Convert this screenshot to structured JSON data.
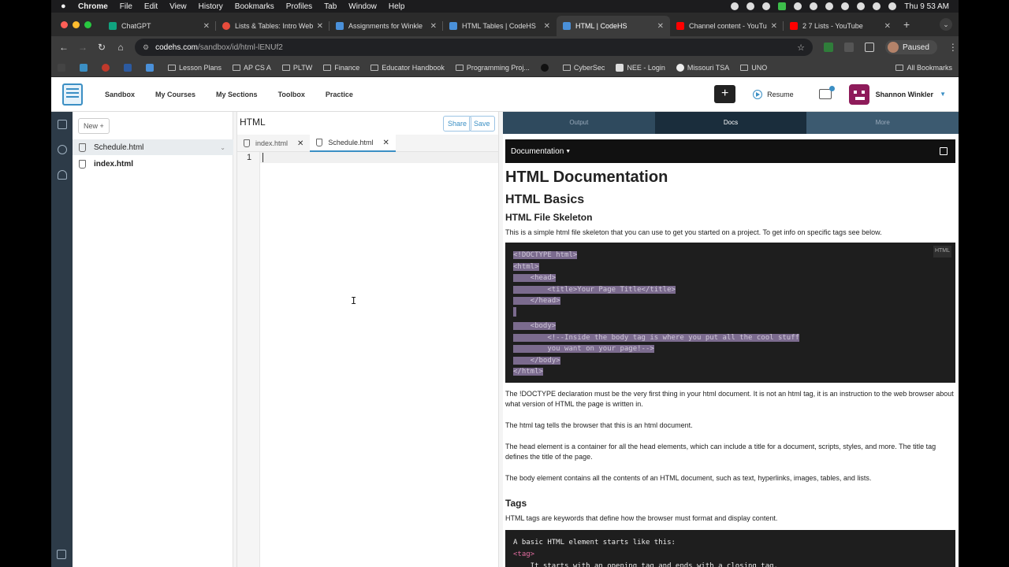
{
  "menubar": {
    "app": "Chrome",
    "items": [
      "File",
      "Edit",
      "View",
      "History",
      "Bookmarks",
      "Profiles",
      "Tab",
      "Window",
      "Help"
    ],
    "clock": "Thu 9 53 AM"
  },
  "tabs": [
    {
      "title": "ChatGPT",
      "color": "#10a37f"
    },
    {
      "title": "Lists & Tables: Intro Web",
      "color": "#e74c3c"
    },
    {
      "title": "Assignments for Winkle",
      "color": "#4a90d9"
    },
    {
      "title": "HTML Tables | CodeHS",
      "color": "#4a90d9"
    },
    {
      "title": "HTML | CodeHS",
      "color": "#4a90d9",
      "active": true
    },
    {
      "title": "Channel content - YouTu",
      "color": "#ff0000"
    },
    {
      "title": "2 7 Lists - YouTube",
      "color": "#ff0000"
    }
  ],
  "address": {
    "host": "codehs.com",
    "path": "/sandbox/id/html-lENUf2"
  },
  "profile": {
    "label": "Paused"
  },
  "bookmarks": [
    "Lesson Plans",
    "AP CS A",
    "PLTW",
    "Finance",
    "Educator Handbook",
    "Programming Proj...",
    "CyberSec",
    "NEE - Login",
    "Missouri TSA",
    "UNO"
  ],
  "bookmarks_all": "All Bookmarks",
  "codehs": {
    "nav": [
      "Sandbox",
      "My Courses",
      "My Sections",
      "Toolbox",
      "Practice"
    ],
    "resume": "Resume",
    "user": "Shannon Winkler",
    "plus": "+"
  },
  "files": {
    "new_button": "New +",
    "items": [
      "Schedule.html",
      "index.html"
    ]
  },
  "editor": {
    "title": "HTML",
    "share": "Share",
    "save": "Save",
    "tabs": [
      "index.html",
      "Schedule.html"
    ],
    "line": "1"
  },
  "panel": {
    "tabs": [
      "Output",
      "Docs",
      "More"
    ],
    "doc_menu": "Documentation",
    "h1": "HTML Documentation",
    "h2": "HTML Basics",
    "h3": "HTML File Skeleton",
    "intro": "This is a simple html file skeleton that you can use to get you started on a project. To get info on specific tags see below.",
    "code_lang": "HTML",
    "code_lines": [
      "<!DOCTYPE html>",
      "<html>",
      "    <head>",
      "        <title>Your Page Title</title>",
      "    </head>",
      "",
      "    <body>",
      "        <!--Inside the body tag is where you put all the cool stuff",
      "        you want on your page!-->",
      "    </body>",
      "</html>"
    ],
    "p1": "The !DOCTYPE declaration must be the very first thing in your html document. It is not an html tag, it is an instruction to the web browser about what version of HTML the page is written in.",
    "p2": "The html tag tells the browser that this is an html document.",
    "p3": "The head element is a container for all the head elements, which can include a title for a document, scripts, styles, and more. The title tag defines the title of the page.",
    "p4": "The body element contains all the contents of an HTML document, such as text, hyperlinks, images, tables, and lists.",
    "tags_h": "Tags",
    "tags_p": "HTML tags are keywords that define how the browser must format and display content.",
    "code2_line1": "A basic HTML element starts like this:",
    "code2_line2": "<tag>",
    "code2_line3": "    It starts with an opening tag and ends with a closing tag."
  }
}
